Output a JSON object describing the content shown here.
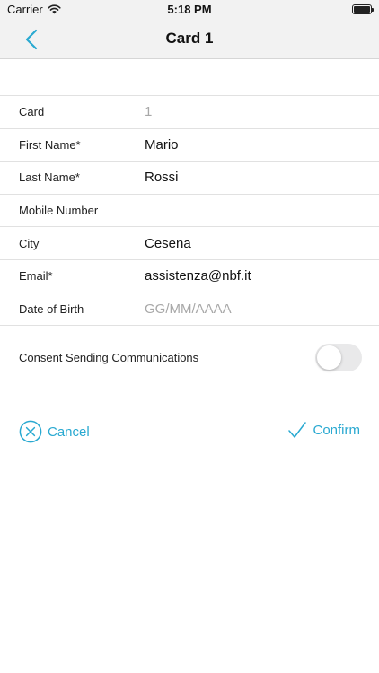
{
  "status_bar": {
    "carrier": "Carrier",
    "time": "5:18 PM"
  },
  "nav": {
    "title": "Card 1"
  },
  "form": {
    "fields": [
      {
        "label": "Card",
        "value": "1",
        "muted": true
      },
      {
        "label": "First Name*",
        "value": "Mario",
        "muted": false
      },
      {
        "label": "Last Name*",
        "value": "Rossi",
        "muted": false
      },
      {
        "label": "Mobile Number",
        "value": "",
        "muted": false
      },
      {
        "label": "City",
        "value": "Cesena",
        "muted": false
      },
      {
        "label": "Email*",
        "value": "assistenza@nbf.it",
        "muted": false
      },
      {
        "label": "Date of Birth",
        "value": "GG/MM/AAAA",
        "muted": true
      }
    ]
  },
  "consent": {
    "label": "Consent Sending Communications",
    "enabled": false
  },
  "actions": {
    "cancel_label": "Cancel",
    "confirm_label": "Confirm"
  },
  "colors": {
    "accent": "#29a9d1",
    "toggle_off": "#e9e9ea"
  }
}
